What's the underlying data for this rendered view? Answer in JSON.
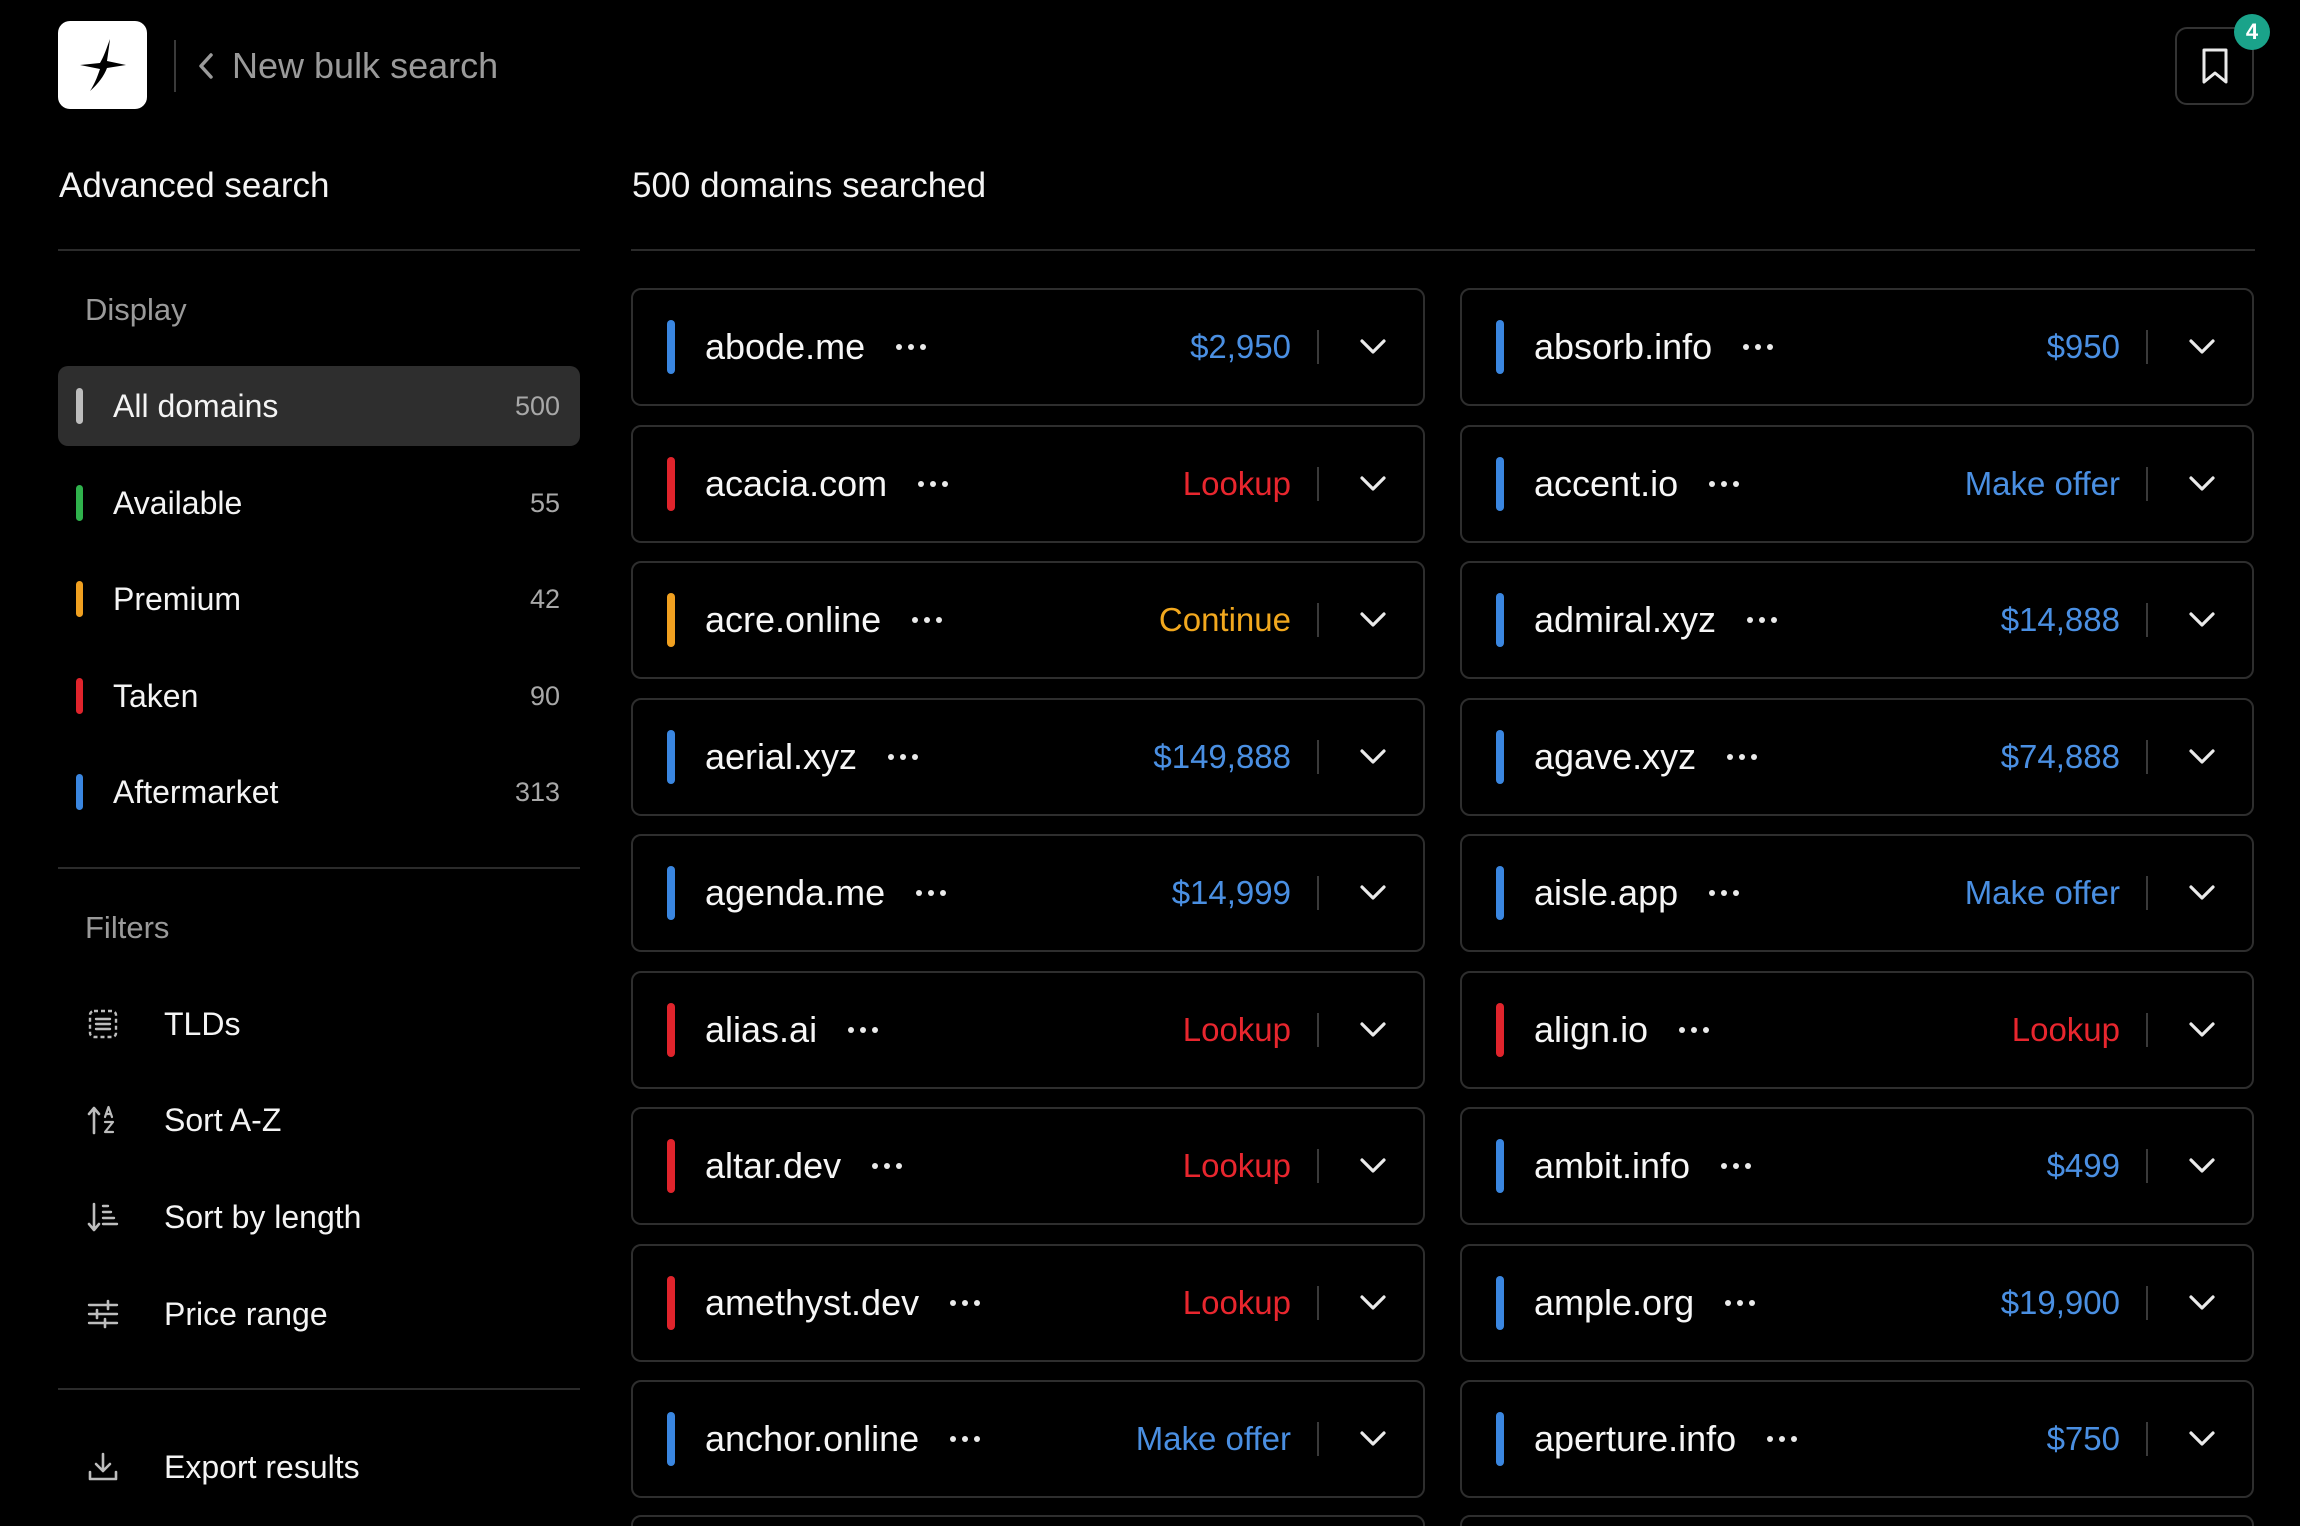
{
  "header": {
    "back_label": "New bulk search",
    "saved_count": "4"
  },
  "sidebar": {
    "title": "Advanced search",
    "display_label": "Display",
    "display_items": [
      {
        "label": "All domains",
        "count": "500",
        "color": "#bdbdbd",
        "active": true
      },
      {
        "label": "Available",
        "count": "55",
        "color": "#2fb24c"
      },
      {
        "label": "Premium",
        "count": "42",
        "color": "#f0a020"
      },
      {
        "label": "Taken",
        "count": "90",
        "color": "#e0242c"
      },
      {
        "label": "Aftermarket",
        "count": "313",
        "color": "#3a86e0"
      }
    ],
    "filters_label": "Filters",
    "filters": [
      {
        "label": "TLDs",
        "icon": "list-icon"
      },
      {
        "label": "Sort A-Z",
        "icon": "sort-az-icon"
      },
      {
        "label": "Sort by length",
        "icon": "sort-length-icon"
      },
      {
        "label": "Price range",
        "icon": "sliders-icon"
      }
    ],
    "export_label": "Export results"
  },
  "main": {
    "title": "500 domains searched",
    "results": [
      [
        {
          "name": "abode.me",
          "action": "$2,950",
          "status": "aftermarket"
        },
        {
          "name": "acacia.com",
          "action": "Lookup",
          "status": "taken"
        },
        {
          "name": "acre.online",
          "action": "Continue",
          "status": "premium"
        },
        {
          "name": "aerial.xyz",
          "action": "$149,888",
          "status": "aftermarket"
        },
        {
          "name": "agenda.me",
          "action": "$14,999",
          "status": "aftermarket"
        },
        {
          "name": "alias.ai",
          "action": "Lookup",
          "status": "taken"
        },
        {
          "name": "altar.dev",
          "action": "Lookup",
          "status": "taken"
        },
        {
          "name": "amethyst.dev",
          "action": "Lookup",
          "status": "taken"
        },
        {
          "name": "anchor.online",
          "action": "Make offer",
          "status": "aftermarket"
        }
      ],
      [
        {
          "name": "absorb.info",
          "action": "$950",
          "status": "aftermarket"
        },
        {
          "name": "accent.io",
          "action": "Make offer",
          "status": "aftermarket"
        },
        {
          "name": "admiral.xyz",
          "action": "$14,888",
          "status": "aftermarket"
        },
        {
          "name": "agave.xyz",
          "action": "$74,888",
          "status": "aftermarket"
        },
        {
          "name": "aisle.app",
          "action": "Make offer",
          "status": "aftermarket"
        },
        {
          "name": "align.io",
          "action": "Lookup",
          "status": "taken"
        },
        {
          "name": "ambit.info",
          "action": "$499",
          "status": "aftermarket"
        },
        {
          "name": "ample.org",
          "action": "$19,900",
          "status": "aftermarket"
        },
        {
          "name": "aperture.info",
          "action": "$750",
          "status": "aftermarket"
        }
      ]
    ]
  },
  "colors": {
    "aftermarket": "#3a86e0",
    "taken": "#e0242c",
    "premium": "#f0a020",
    "available": "#2fb24c",
    "action_aftermarket": "#4a8fe2",
    "action_taken": "#e8262e",
    "action_premium": "#f2a81e"
  }
}
